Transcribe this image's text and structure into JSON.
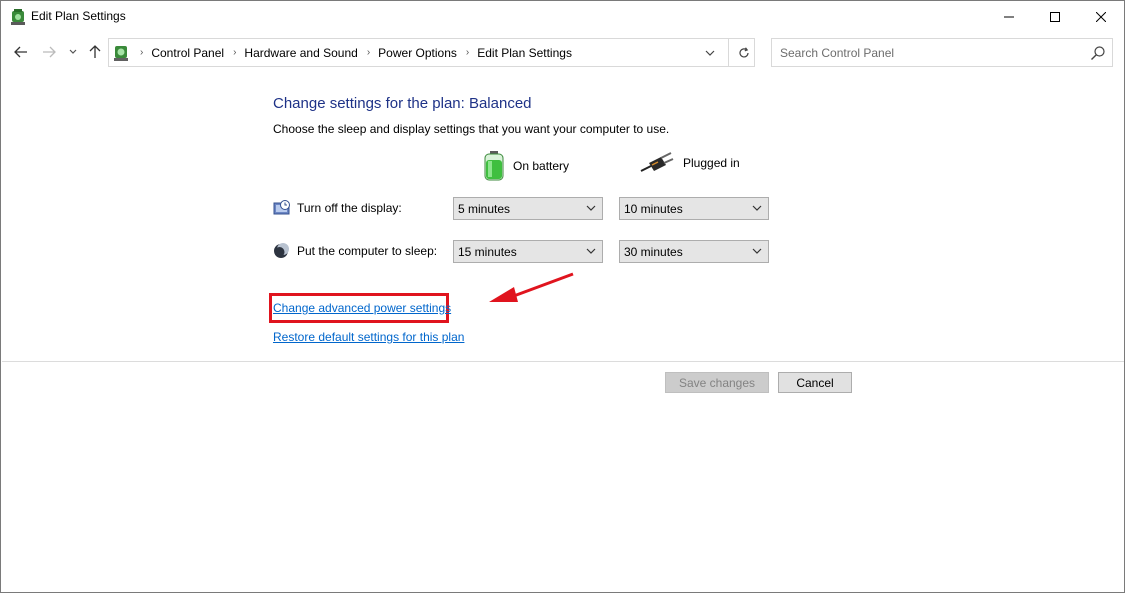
{
  "window": {
    "title": "Edit Plan Settings"
  },
  "breadcrumb": {
    "items": [
      "Control Panel",
      "Hardware and Sound",
      "Power Options",
      "Edit Plan Settings"
    ]
  },
  "search": {
    "placeholder": "Search Control Panel"
  },
  "main": {
    "heading": "Change settings for the plan: Balanced",
    "subtext": "Choose the sleep and display settings that you want your computer to use.",
    "columns": {
      "battery": "On battery",
      "plugged": "Plugged in"
    },
    "rows": [
      {
        "label": "Turn off the display:",
        "battery_value": "5 minutes",
        "plugged_value": "10 minutes",
        "icon": "display-timer-icon"
      },
      {
        "label": "Put the computer to sleep:",
        "battery_value": "15 minutes",
        "plugged_value": "30 minutes",
        "icon": "sleep-moon-icon"
      }
    ],
    "links": {
      "advanced": "Change advanced power settings",
      "restore": "Restore default settings for this plan"
    },
    "buttons": {
      "save": "Save changes",
      "cancel": "Cancel"
    }
  },
  "colors": {
    "heading": "#1e3287",
    "link": "#0066cc",
    "annotation": "#e0141e"
  }
}
